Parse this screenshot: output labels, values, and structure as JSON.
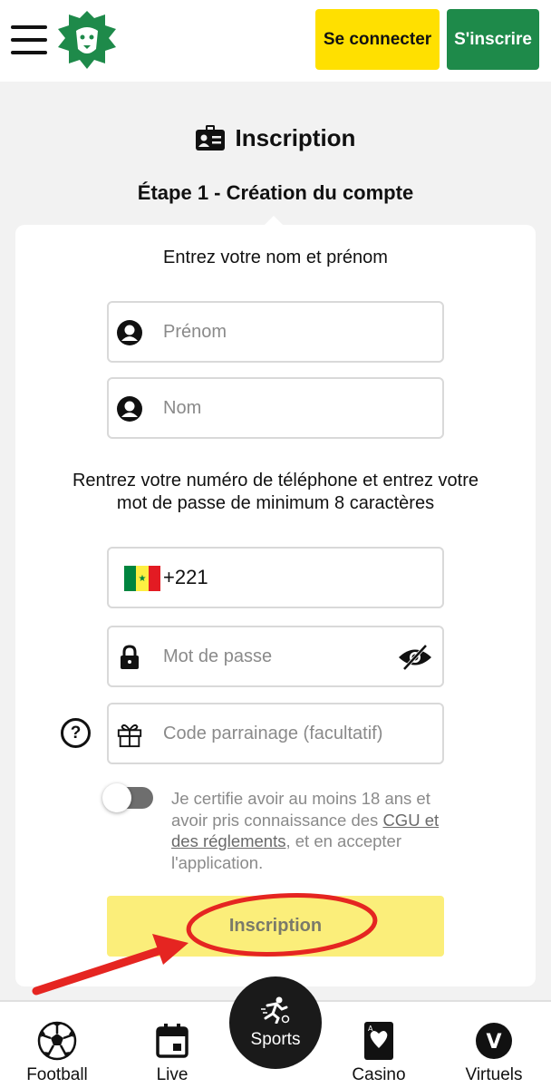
{
  "header": {
    "menu_icon": "hamburger-menu-icon",
    "logo": "lion-head-logo",
    "login_label": "Se connecter",
    "signup_label": "S'inscrire",
    "colors": {
      "login_bg": "#ffe000",
      "signup_bg": "#1e8a4a"
    }
  },
  "page": {
    "title": "Inscription",
    "title_icon": "id-card-icon",
    "step_title": "Étape 1 - Création du compte"
  },
  "form": {
    "name_prompt": "Entrez votre nom et prénom",
    "first_name_placeholder": "Prénom",
    "last_name_placeholder": "Nom",
    "phone_prompt_line1": "Rentrez votre numéro de téléphone et entrez votre",
    "phone_prompt_line2": "mot de passe de minimum 8 caractères",
    "country_flag": "senegal-flag",
    "phone_code": "+221",
    "password_placeholder": "Mot de passe",
    "referral_placeholder": "Code parrainage (facultatif)",
    "help_symbol": "?",
    "terms_before": "Je certifie avoir au moins 18 ans et avoir pris connaissance des ",
    "terms_link": "CGU et des réglements",
    "terms_after": ", et en accepter l'application.",
    "toggle_on": false,
    "submit_label": "Inscription",
    "submit_bg": "#fbee7a"
  },
  "bottom_nav": {
    "items": [
      {
        "label": "Football",
        "icon": "soccer-ball-icon"
      },
      {
        "label": "Live",
        "icon": "calendar-icon"
      },
      {
        "label": "Sports",
        "icon": "running-player-icon"
      },
      {
        "label": "Casino",
        "icon": "playing-card-icon"
      },
      {
        "label": "Virtuels",
        "icon": "v-circle-icon"
      }
    ]
  }
}
